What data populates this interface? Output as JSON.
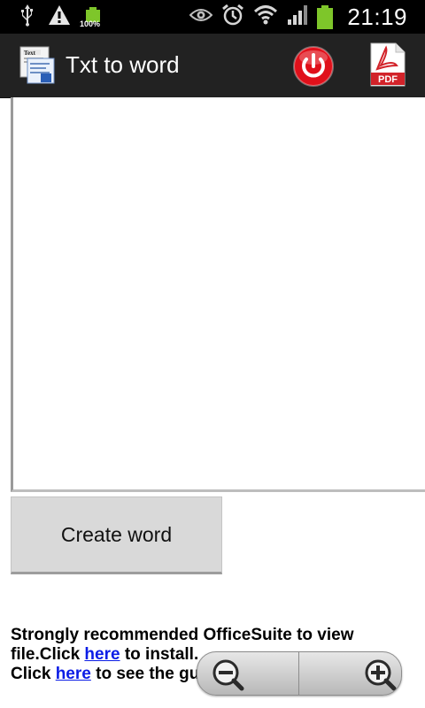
{
  "statusbar": {
    "battery_small_percent": "100%",
    "time": "21:19",
    "icons": [
      "usb-icon",
      "warning-icon",
      "battery-full-icon",
      "eye-icon",
      "alarm-icon",
      "wifi-icon",
      "signal-icon",
      "battery-icon"
    ]
  },
  "actionbar": {
    "title": "Txt to word",
    "app_icon": "txt-to-word-app-icon",
    "actions": [
      "power-icon",
      "pdf-icon"
    ],
    "pdf_label": "PDF"
  },
  "editor": {
    "value": ""
  },
  "create_button": {
    "label": "Create word"
  },
  "info": {
    "line1": "Strongly recommended OfficeSuite to view",
    "line2_pre": "file.Click ",
    "link1": "here",
    "line2_post": " to install.",
    "line3_pre": "Click ",
    "link2": "here",
    "line3_post": " to see the gui"
  },
  "zoom": {
    "out_icon": "zoom-out-icon",
    "in_icon": "zoom-in-icon"
  },
  "colors": {
    "actionbar": "#222222",
    "link": "#0b1de6",
    "button_bg": "#d9d9d9",
    "battery_green": "#7ec62a",
    "power_red": "#e0101a"
  }
}
